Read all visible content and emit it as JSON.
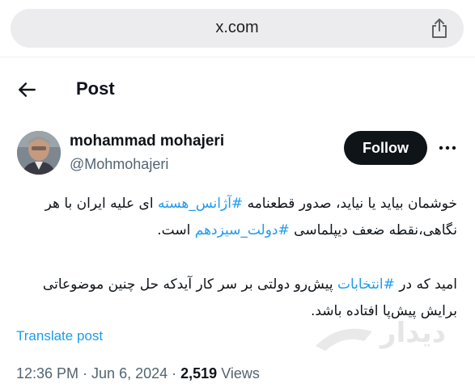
{
  "browser": {
    "url": "x.com"
  },
  "header": {
    "title": "Post"
  },
  "author": {
    "name": "mohammad mohajeri",
    "handle": "@Mohmohajeri",
    "follow_label": "Follow"
  },
  "tweet": {
    "p1_prefix": "خوشمان بیاید یا نیاید، صدور قطعنامه ",
    "p1_tag1": "#آژانس_هسته",
    "p1_mid": " ای علیه ایران با هر نگاهی،نقطه ضعف دیپلماسی ",
    "p1_tag2": "#دولت_سیزدهم",
    "p1_suffix": " است.",
    "p2_prefix": "امید که در ",
    "p2_tag": "#انتخابات",
    "p2_suffix": " پیش‌رو دولتی بر سر کار آیدکه حل چنین موضوعاتی برایش پیش‌پا افتاده باشد."
  },
  "translate_label": "Translate post",
  "meta": {
    "time": "12:36 PM",
    "date": "Jun 6, 2024",
    "views_count": "2,519",
    "views_label": "Views"
  },
  "watermark": {
    "text": "دیدار"
  },
  "colors": {
    "accent": "#1d9bf0",
    "text": "#0f1419",
    "secondary": "#536471",
    "button": "#0f1419"
  }
}
